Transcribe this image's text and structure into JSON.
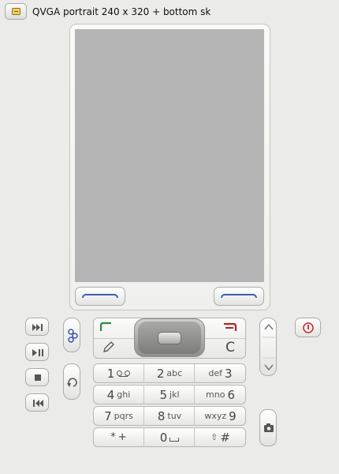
{
  "window": {
    "title": "QVGA portrait 240 x 320 + bottom sk"
  },
  "colors": {
    "background": "#ebebea",
    "screen": "#b4b4b4",
    "softkey_accent": "#3d5fae",
    "call_green": "#2e8b3d",
    "end_red": "#b0242a",
    "power_red": "#c22a2a",
    "menu_icon": "#f3d35d"
  },
  "icons": {
    "menu": "window-menu-icon",
    "next_track": "next-track-icon",
    "play_pause": "play-pause-icon",
    "stop": "stop-icon",
    "previous_track": "previous-track-icon",
    "apps": "application-key-icon",
    "back": "back-key-icon",
    "call": "call-key-icon",
    "end": "end-key-icon",
    "edit": "edit-pencil-icon",
    "volume_up": "volume-up-icon",
    "volume_down": "volume-down-icon",
    "power": "power-icon",
    "camera": "camera-icon"
  },
  "nav": {
    "clear_label": "C"
  },
  "keypad": [
    [
      {
        "digit": "1",
        "letters": ""
      },
      {
        "digit": "2",
        "letters": "abc"
      },
      {
        "digit": "3",
        "letters": "def"
      }
    ],
    [
      {
        "digit": "4",
        "letters": "ghi"
      },
      {
        "digit": "5",
        "letters": "jkl"
      },
      {
        "digit": "6",
        "letters": "mno"
      }
    ],
    [
      {
        "digit": "7",
        "letters": "pqrs"
      },
      {
        "digit": "8",
        "letters": "tuv"
      },
      {
        "digit": "9",
        "letters": "wxyz"
      }
    ],
    [
      {
        "digit": "*",
        "letters": "+"
      },
      {
        "digit": "0",
        "letters": ""
      },
      {
        "digit": "#",
        "letters": "⇧"
      }
    ]
  ]
}
